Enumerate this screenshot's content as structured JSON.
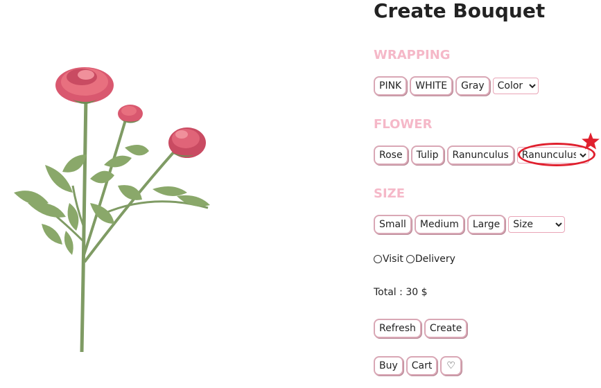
{
  "page": {
    "title": "Create Bouquet"
  },
  "wrapping": {
    "heading": "WRAPPING",
    "options": [
      "PINK",
      "WHITE",
      "Gray"
    ],
    "select_value": "Color"
  },
  "flower": {
    "heading": "FLOWER",
    "options": [
      "Rose",
      "Tulip",
      "Ranunculus"
    ],
    "select_value": "Ranunculus"
  },
  "size": {
    "heading": "SIZE",
    "options": [
      "Small",
      "Medium",
      "Large"
    ],
    "select_value": "Size"
  },
  "delivery": {
    "options": [
      "Visit",
      "Delivery"
    ]
  },
  "total": {
    "text": "Total : 30 $"
  },
  "actions": {
    "refresh_label": "Refresh",
    "create_label": "Create",
    "buy_label": "Buy",
    "cart_label": "Cart",
    "favorite_label": "♡"
  },
  "colors": {
    "accent_pink": "#f5b8c8",
    "annotation_red": "#e0202e"
  }
}
